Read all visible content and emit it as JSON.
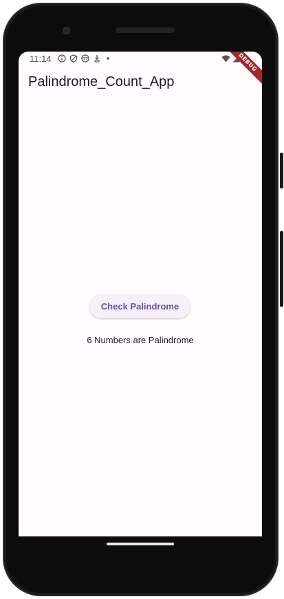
{
  "status_bar": {
    "time": "11:14",
    "left_icons": [
      "info-icon",
      "shield-icon",
      "face-icon",
      "download-icon",
      "dot-icon"
    ],
    "right_icons": [
      "wifi-icon",
      "signal-icon",
      "battery-icon"
    ]
  },
  "debug_banner": {
    "label": "DEBUG"
  },
  "app_bar": {
    "title": "Palindrome_Count_App"
  },
  "main": {
    "check_button_label": "Check Palindrome",
    "result_text": "6 Numbers are Palindrome"
  },
  "colors": {
    "screen_background": "#fffbfe",
    "button_text": "#6750a4",
    "button_background": "#f6f0f8",
    "debug_ribbon": "#a2282d",
    "phone_frame": "#0c0c0c"
  }
}
